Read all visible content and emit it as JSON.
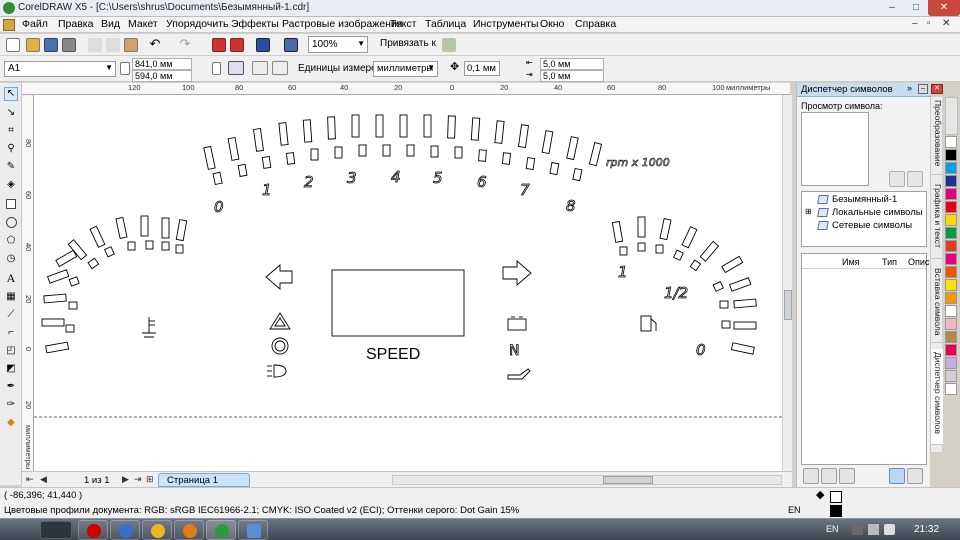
{
  "window": {
    "title": "CorelDRAW X5 - [C:\\Users\\shrus\\Documents\\Безымянный-1.cdr]",
    "min": "–",
    "max": "□",
    "close": "✕"
  },
  "menu": {
    "items": [
      "Файл",
      "Правка",
      "Вид",
      "Макет",
      "Упорядочить",
      "Эффекты",
      "Растровые изображения",
      "Текст",
      "Таблица",
      "Инструменты",
      "Окно",
      "Справка"
    ],
    "doc_controls": [
      "–",
      "▫",
      "✕"
    ]
  },
  "toolbar": {
    "zoom": "100%",
    "snap_label": "Привязать к"
  },
  "property_bar": {
    "paper": "A1",
    "width": "841,0 мм",
    "height": "594,0 мм",
    "units_label": "Единицы измерения:",
    "units": "миллиметры",
    "nudge": "0,1 мм",
    "dup_x": "5,0 мм",
    "dup_y": "5,0 мм"
  },
  "ruler": {
    "h_labels": [
      "120",
      "100",
      "80",
      "60",
      "40",
      "20",
      "0",
      "20",
      "40",
      "60",
      "80",
      "100",
      "120"
    ],
    "units": "миллиметры",
    "v_labels": [
      "80",
      "60",
      "40",
      "20",
      "0",
      "20",
      "40",
      "60"
    ],
    "v_units": "миллиметры"
  },
  "canvas": {
    "rpm_label": "rpm x 1000",
    "rpm_numbers": [
      "0",
      "1",
      "2",
      "3",
      "4",
      "5",
      "6",
      "7",
      "8"
    ],
    "speed_label": "SPEED",
    "temp_label": "1",
    "fuel_half": "1/2",
    "fuel_empty": "0",
    "gear_label": "N"
  },
  "pagebar": {
    "page_count": "1 из 1",
    "page_tab": "Страница 1"
  },
  "status": {
    "coords": "( -86,396; 41,440 )",
    "profiles": "Цветовые профили документа: RGB: sRGB IEC61966-2.1; CMYK: ISO Coated v2 (ECI); Оттенки серого: Dot Gain 15%",
    "lang": "EN"
  },
  "docker": {
    "title": "Диспетчер символов",
    "preview_label": "Просмотр символа:",
    "tree": [
      "Безымянный-1",
      "Локальные символы",
      "Сетевые символы"
    ],
    "columns": [
      "Имя",
      "Тип",
      "Опис"
    ]
  },
  "docker_tabs": [
    "Преобразование",
    "Графика и текст",
    "Вставка символа",
    "Диспетчер символов"
  ],
  "palette": [
    "#ffffff",
    "#000000",
    "#00a0e9",
    "#1e2f9a",
    "#e4007f",
    "#e60012",
    "#ffd800",
    "#009944",
    "#e83828",
    "#e4007f",
    "#ea5506",
    "#ffe100",
    "#f39800",
    "#ffffff",
    "#f4b4c5",
    "#b28850",
    "#e5005a",
    "#c5aee0",
    "#d0d0d0",
    "#ffffff"
  ],
  "taskbar": {
    "clock": "21:32",
    "lang": "EN"
  }
}
